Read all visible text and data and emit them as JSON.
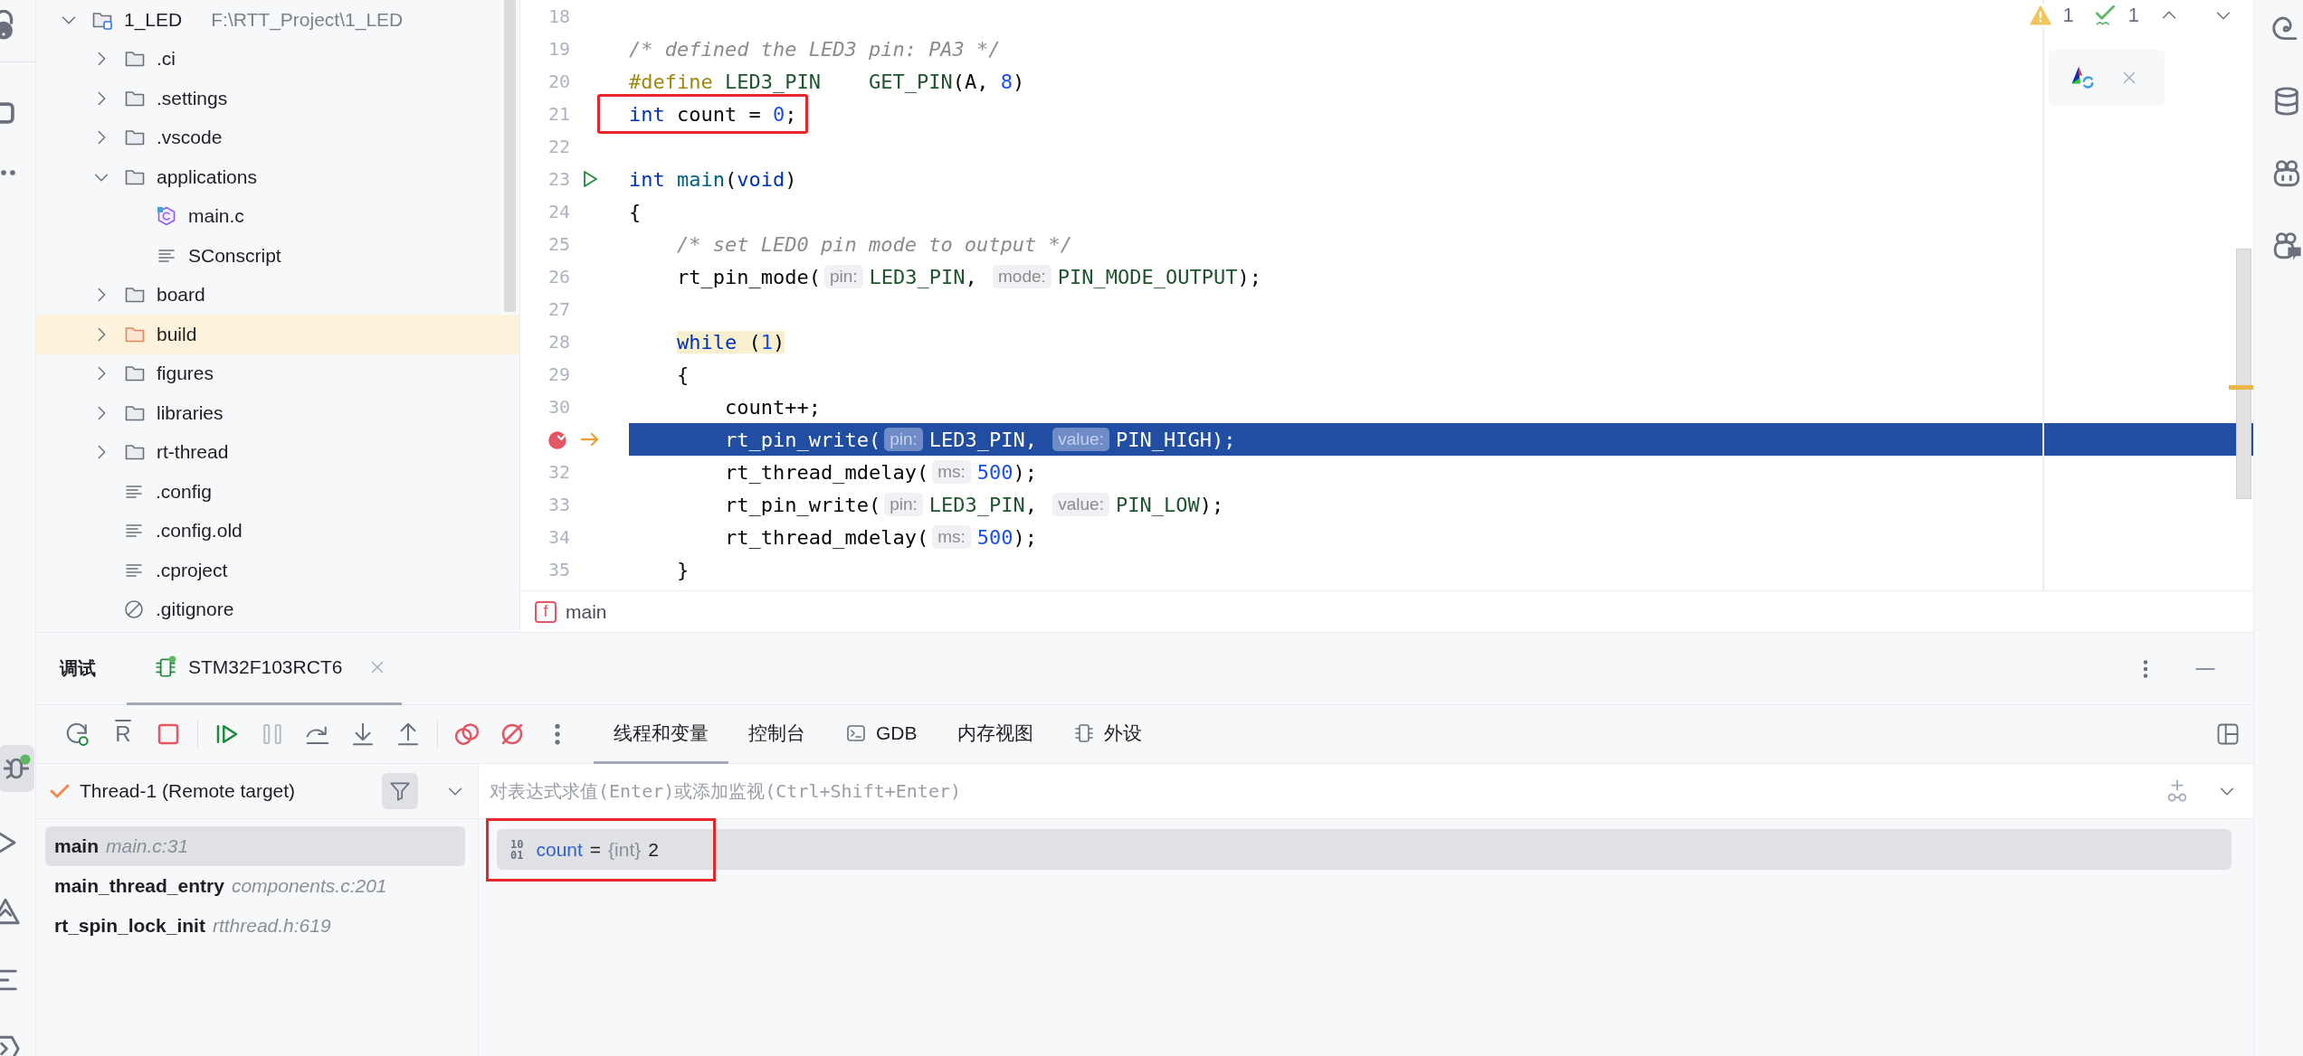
{
  "left_toolbar": {
    "top": [
      {
        "kind": "lock",
        "selected": false
      },
      {
        "kind": "square",
        "selected": false
      },
      {
        "kind": "more",
        "selected": false
      }
    ],
    "bottom": [
      {
        "kind": "debug",
        "selected": true
      },
      {
        "kind": "run",
        "selected": false
      },
      {
        "kind": "problems",
        "selected": false
      },
      {
        "kind": "structure",
        "selected": false
      },
      {
        "kind": "terminal",
        "selected": false
      }
    ]
  },
  "project_tree": {
    "items": [
      {
        "name": "1_LED",
        "path": "F:\\RTT_Project\\1_LED",
        "kind": "module",
        "expanded": true,
        "selected": false,
        "children": [
          {
            "name": ".ci",
            "kind": "folder",
            "expanded": false,
            "selected": false
          },
          {
            "name": ".settings",
            "kind": "folder",
            "expanded": false,
            "selected": false
          },
          {
            "name": ".vscode",
            "kind": "folder",
            "expanded": false,
            "selected": false
          },
          {
            "name": "applications",
            "kind": "folder",
            "expanded": true,
            "selected": false,
            "children": [
              {
                "name": "main.c",
                "kind": "c-file",
                "selected": false
              },
              {
                "name": "SConscript",
                "kind": "text-file",
                "selected": false
              }
            ]
          },
          {
            "name": "board",
            "kind": "folder",
            "expanded": false,
            "selected": false
          },
          {
            "name": "build",
            "kind": "excluded-folder",
            "expanded": false,
            "selected": true
          },
          {
            "name": "figures",
            "kind": "folder",
            "expanded": false,
            "selected": false
          },
          {
            "name": "libraries",
            "kind": "folder",
            "expanded": false,
            "selected": false
          },
          {
            "name": "rt-thread",
            "kind": "folder",
            "expanded": false,
            "selected": false
          },
          {
            "name": ".config",
            "kind": "text-file",
            "selected": false
          },
          {
            "name": ".config.old",
            "kind": "text-file",
            "selected": false
          },
          {
            "name": ".cproject",
            "kind": "text-file",
            "selected": false
          },
          {
            "name": ".gitignore",
            "kind": "ignore-file",
            "selected": false
          }
        ]
      }
    ]
  },
  "editor": {
    "lines": [
      {
        "number": "18",
        "current": false,
        "annotated": false,
        "breakpoint": false,
        "run_marker": false
      },
      {
        "number": "19",
        "current": false,
        "annotated": false,
        "breakpoint": false,
        "run_marker": false,
        "tokens": [
          {
            "kind": "comment",
            "text": "/* defined the LED3 pin: PA3 */"
          }
        ]
      },
      {
        "number": "20",
        "current": false,
        "annotated": false,
        "breakpoint": false,
        "run_marker": false,
        "tokens": [
          {
            "kind": "directive",
            "text": "#define "
          },
          {
            "kind": "macro",
            "text": "LED3_PIN    "
          },
          {
            "kind": "macro",
            "text": "GET_PIN"
          },
          {
            "kind": "plain",
            "text": "(A, "
          },
          {
            "kind": "number",
            "text": "8"
          },
          {
            "kind": "plain",
            "text": ")"
          }
        ]
      },
      {
        "number": "21",
        "current": false,
        "annotated": true,
        "breakpoint": false,
        "run_marker": false,
        "tokens": [
          {
            "kind": "keyword",
            "text": "int"
          },
          {
            "kind": "plain",
            "text": " count = "
          },
          {
            "kind": "number",
            "text": "0"
          },
          {
            "kind": "plain",
            "text": ";"
          }
        ]
      },
      {
        "number": "22",
        "current": false,
        "annotated": false,
        "breakpoint": false,
        "run_marker": false
      },
      {
        "number": "23",
        "current": false,
        "annotated": false,
        "breakpoint": false,
        "run_marker": true,
        "tokens": [
          {
            "kind": "keyword",
            "text": "int "
          },
          {
            "kind": "function",
            "text": "main"
          },
          {
            "kind": "plain",
            "text": "("
          },
          {
            "kind": "keyword",
            "text": "void"
          },
          {
            "kind": "plain",
            "text": ")"
          }
        ]
      },
      {
        "number": "24",
        "current": false,
        "annotated": false,
        "breakpoint": false,
        "run_marker": false,
        "tokens": [
          {
            "kind": "plain",
            "text": "{"
          }
        ]
      },
      {
        "number": "25",
        "current": false,
        "annotated": false,
        "breakpoint": false,
        "run_marker": false,
        "tokens": [
          {
            "kind": "comment",
            "text": "    /* set LED0 pin mode to output */"
          }
        ]
      },
      {
        "number": "26",
        "current": false,
        "annotated": false,
        "breakpoint": false,
        "run_marker": false,
        "tokens": [
          {
            "kind": "plain",
            "text": "    rt_pin_mode("
          },
          {
            "kind": "hint",
            "text": "pin:"
          },
          {
            "kind": "macro",
            "text": "LED3_PIN"
          },
          {
            "kind": "plain",
            "text": ", "
          },
          {
            "kind": "hint",
            "text": "mode:"
          },
          {
            "kind": "macro",
            "text": "PIN_MODE_OUTPUT"
          },
          {
            "kind": "plain",
            "text": ");"
          }
        ]
      },
      {
        "number": "27",
        "current": false,
        "annotated": false,
        "breakpoint": false,
        "run_marker": false
      },
      {
        "number": "28",
        "current": false,
        "annotated": false,
        "breakpoint": false,
        "run_marker": false,
        "tokens": [
          {
            "kind": "keyword",
            "text": "    while ",
            "highlighted": true
          },
          {
            "kind": "plain",
            "text": "(",
            "highlighted": true
          },
          {
            "kind": "number",
            "text": "1",
            "highlighted": true
          },
          {
            "kind": "plain",
            "text": ")",
            "highlighted": true
          }
        ]
      },
      {
        "number": "29",
        "current": false,
        "annotated": false,
        "breakpoint": false,
        "run_marker": false,
        "tokens": [
          {
            "kind": "plain",
            "text": "    {"
          }
        ]
      },
      {
        "number": "30",
        "current": false,
        "annotated": false,
        "breakpoint": false,
        "run_marker": false,
        "tokens": [
          {
            "kind": "plain",
            "text": "        count++;"
          }
        ]
      },
      {
        "current": true,
        "annotated": false,
        "breakpoint": true,
        "run_marker": false,
        "tokens": [
          {
            "kind": "plain",
            "text": "        rt_pin_write("
          },
          {
            "kind": "hint",
            "text": "pin:"
          },
          {
            "kind": "macro",
            "text": "LED3_PIN"
          },
          {
            "kind": "plain",
            "text": ", "
          },
          {
            "kind": "hint",
            "text": "value:"
          },
          {
            "kind": "macro",
            "text": "PIN_HIGH"
          },
          {
            "kind": "plain",
            "text": ");"
          }
        ]
      },
      {
        "number": "32",
        "current": false,
        "annotated": false,
        "breakpoint": false,
        "run_marker": false,
        "tokens": [
          {
            "kind": "plain",
            "text": "        rt_thread_mdelay("
          },
          {
            "kind": "hint",
            "text": "ms:"
          },
          {
            "kind": "number",
            "text": "500"
          },
          {
            "kind": "plain",
            "text": ");"
          }
        ]
      },
      {
        "number": "33",
        "current": false,
        "annotated": false,
        "breakpoint": false,
        "run_marker": false,
        "tokens": [
          {
            "kind": "plain",
            "text": "        rt_pin_write("
          },
          {
            "kind": "hint",
            "text": "pin:"
          },
          {
            "kind": "macro",
            "text": "LED3_PIN"
          },
          {
            "kind": "plain",
            "text": ", "
          },
          {
            "kind": "hint",
            "text": "value:"
          },
          {
            "kind": "macro",
            "text": "PIN_LOW"
          },
          {
            "kind": "plain",
            "text": ");"
          }
        ]
      },
      {
        "number": "34",
        "current": false,
        "annotated": false,
        "breakpoint": false,
        "run_marker": false,
        "tokens": [
          {
            "kind": "plain",
            "text": "        rt_thread_mdelay("
          },
          {
            "kind": "hint",
            "text": "ms:"
          },
          {
            "kind": "number",
            "text": "500"
          },
          {
            "kind": "plain",
            "text": ");"
          }
        ]
      },
      {
        "number": "35",
        "current": false,
        "annotated": false,
        "breakpoint": false,
        "run_marker": false,
        "tokens": [
          {
            "kind": "plain",
            "text": "    }"
          }
        ]
      }
    ],
    "inspections": {
      "warnings": "1",
      "checks": "1"
    },
    "breadcrumb": {
      "badge": "f",
      "label": "main"
    }
  },
  "debug": {
    "title": "调试",
    "sessions": [
      {
        "label": "STM32F103RCT6",
        "selected": true
      }
    ],
    "toolbar": [
      [
        {
          "kind": "rerun",
          "disabled": false
        },
        {
          "kind": "letter",
          "text": "R",
          "disabled": false
        },
        {
          "kind": "stop",
          "disabled": false
        }
      ],
      [
        {
          "kind": "resume",
          "disabled": false
        },
        {
          "kind": "pause",
          "disabled": true
        },
        {
          "kind": "step-over",
          "disabled": false
        },
        {
          "kind": "step-into",
          "disabled": false
        },
        {
          "kind": "step-out",
          "disabled": false
        }
      ],
      [
        {
          "kind": "breakpoints",
          "disabled": false
        },
        {
          "kind": "mute",
          "disabled": false
        },
        {
          "kind": "more",
          "disabled": false
        }
      ]
    ],
    "tabs": [
      {
        "label": "线程和变量",
        "kind": "plain",
        "selected": true
      },
      {
        "label": "控制台",
        "kind": "plain",
        "selected": false
      },
      {
        "label": "GDB",
        "kind": "terminal",
        "selected": false
      },
      {
        "label": "内存视图",
        "kind": "plain",
        "selected": false
      },
      {
        "label": "外设",
        "kind": "chip",
        "selected": false
      }
    ],
    "thread": "Thread-1 (Remote target)",
    "frames": [
      {
        "function": "main",
        "location": "main.c:31",
        "selected": true
      },
      {
        "function": "main_thread_entry",
        "location": "components.c:201",
        "selected": false
      },
      {
        "function": "rt_spin_lock_init",
        "location": "rtthread.h:619",
        "selected": false
      }
    ],
    "watch": {
      "placeholder": "对表达式求值(Enter)或添加监视(Ctrl+Shift+Enter)"
    },
    "variables": [
      {
        "badge_lines": [
          "10",
          "01"
        ],
        "name": "count",
        "operator": "=",
        "type": "{int}",
        "value": "2",
        "selected": true,
        "annotated": true
      }
    ]
  },
  "right_toolbar": [
    {
      "kind": "spiral"
    },
    {
      "kind": "database"
    },
    {
      "kind": "robot"
    },
    {
      "kind": "robot-chat"
    }
  ]
}
